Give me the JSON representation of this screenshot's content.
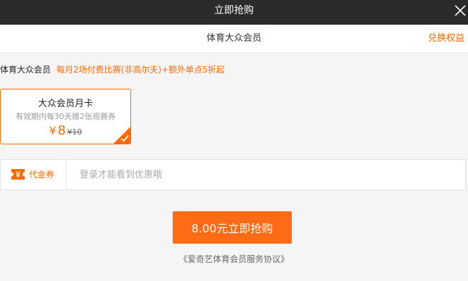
{
  "titlebar": {
    "title": "立即抢购"
  },
  "subbar": {
    "title": "体育大众会员",
    "redeem_label": "兑换权益"
  },
  "membership": {
    "name": "体育大众会员",
    "description": "每月2场付费比赛(非高尔夫)+额外单点5折起"
  },
  "plan": {
    "name": "大众会员月卡",
    "subtitle": "有效期内每30天赠2张观赛券",
    "currency": "¥",
    "price": "8",
    "original_price": "¥10",
    "selected": true
  },
  "coupon": {
    "label": "代金券",
    "placeholder": "登录才能看到优惠哦",
    "value": ""
  },
  "purchase": {
    "button_label": "8.00元立即抢购"
  },
  "agreement": {
    "text": "《爱奇艺体育会员服务协议》"
  },
  "icons": {
    "close": "close-icon",
    "ticket": "ticket-icon",
    "check": "checkmark-icon"
  },
  "colors": {
    "accent": "#ff6a00",
    "titlebar": "#2b2b2b",
    "background": "#f5f5f5"
  }
}
